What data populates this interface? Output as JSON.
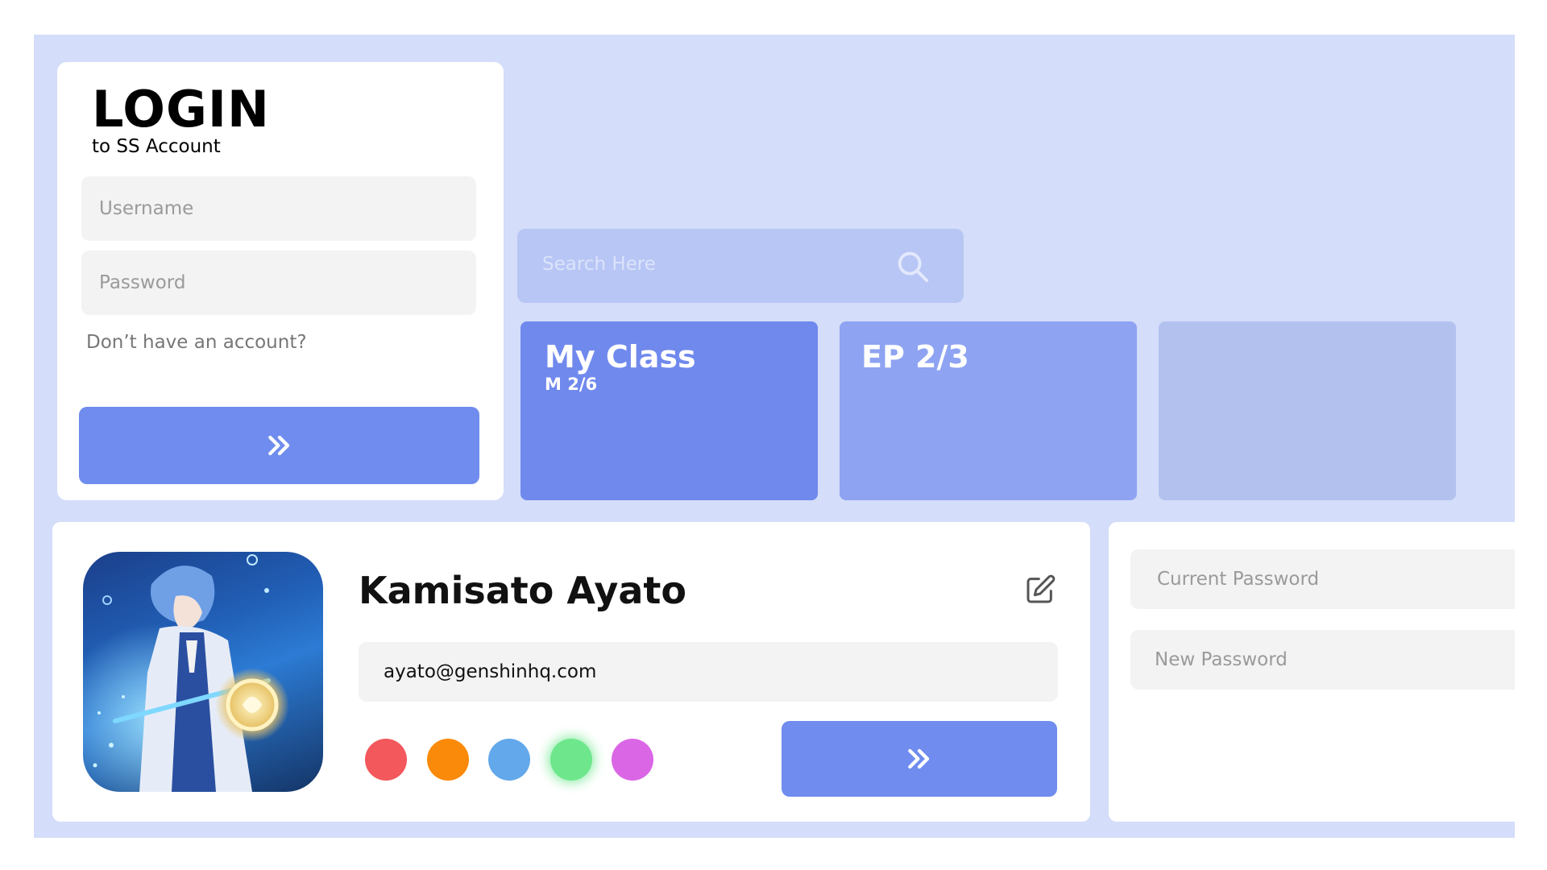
{
  "login": {
    "title": "LOGIN",
    "subtitle": "to SS Account",
    "username_placeholder": "Username",
    "password_placeholder": "Password",
    "signup_link": "Don’t have an account?",
    "submit_icon": "double-chevron-right-icon"
  },
  "search": {
    "placeholder": "Search Here",
    "icon": "search-icon"
  },
  "tiles": [
    {
      "title": "My Class",
      "subtitle": "M 2/6"
    },
    {
      "title": "EP 2/3",
      "subtitle": ""
    },
    {
      "title": "",
      "subtitle": ""
    }
  ],
  "profile": {
    "name": "Kamisato Ayato",
    "email": "ayato@genshinhq.com",
    "edit_icon": "edit-icon",
    "avatar": "character-avatar",
    "swatches": [
      "#f2585c",
      "#fa8a0a",
      "#62a8ea",
      "#6ee78c",
      "#da66e6"
    ],
    "selected_swatch": 3,
    "submit_icon": "double-chevron-right-icon"
  },
  "password": {
    "current_placeholder": "Current Password",
    "new_placeholder": "New Password"
  },
  "colors": {
    "background": "#d4ddf9",
    "accent": "#6f8cee",
    "tile_1": "#7089ed",
    "tile_2": "#8ea3f2",
    "tile_3": "#b3c1ef",
    "search_bg": "#b8c6f5"
  }
}
